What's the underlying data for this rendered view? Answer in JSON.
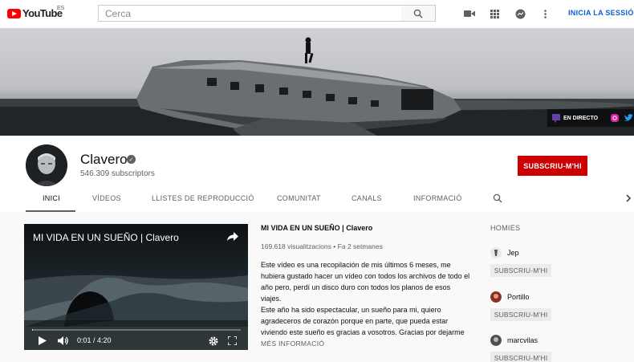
{
  "topbar": {
    "logo_text": "YouTube",
    "logo_region": "ES",
    "search_placeholder": "Cerca",
    "icons": [
      "video-camera-icon",
      "apps-grid-icon",
      "messages-icon",
      "more-vert-icon",
      "search-icon"
    ],
    "signin_label": "INICIA LA SESSIÓ",
    "accent_color": "#065fd4"
  },
  "banner": {
    "live_label": "EN DIRECTO",
    "links_icons": [
      "twitch-icon",
      "instagram-icon",
      "twitter-icon"
    ]
  },
  "channel": {
    "name": "Clavero",
    "subscribers": "546.309 subscriptors",
    "subscribe_label": "SUBSCRIU-M'HI",
    "subscribe_color": "#cc0000"
  },
  "tabs": [
    {
      "label": "INICI",
      "active": true
    },
    {
      "label": "VÍDEOS"
    },
    {
      "label": "LLISTES DE REPRODUCCIÓ"
    },
    {
      "label": "COMUNITAT"
    },
    {
      "label": "CANALS"
    },
    {
      "label": "INFORMACIÓ"
    }
  ],
  "video": {
    "title": "MI VIDA EN UN SUEÑO | Clavero",
    "time": "0:01 / 4:20",
    "progress": 0.004
  },
  "info": {
    "title": "MI VIDA EN UN SUEÑO | Clavero",
    "views": "169.618 visualitzacions",
    "separator": "•",
    "age": "Fa 2 setmanes",
    "desc_1": "Este vídeo es una recopilación de mis últimos 6 meses, me hubiera gustado hacer un vídeo con todos los archivos de todo el año pero, perdí un disco duro con todos los planos de esos viajes.",
    "desc_2": "Este año ha sido espectacular, un sueño para mi, quiero agradeceros de corazón porque en parte, que pueda estar viviendo este sueño es gracias a vosotros. Gracias por dejarme",
    "more_label": "MÉS INFORMACIÓ"
  },
  "sidebar": {
    "title": "HOMIES",
    "items": [
      {
        "name": "Jep",
        "button": "SUBSCRIU-M'HI"
      },
      {
        "name": "Portillo",
        "button": "SUBSCRIU-M'HI"
      },
      {
        "name": "marcvilas",
        "button": "SUBSCRIU-M'HI"
      }
    ]
  }
}
